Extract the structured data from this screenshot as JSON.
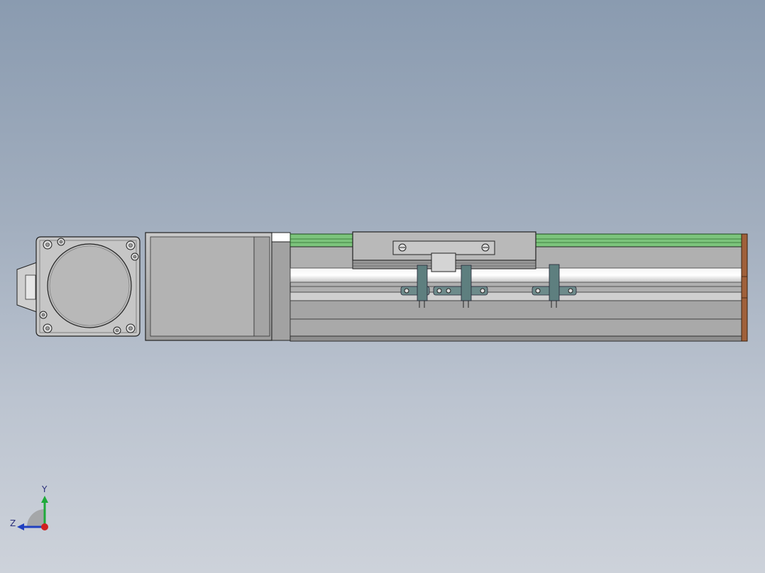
{
  "viewport": {
    "background_top": "#8a9bb0",
    "background_bottom": "#cdd2da"
  },
  "model": {
    "parts": [
      "stepper-motor",
      "motor-flange",
      "coupling-housing",
      "linear-rail-body",
      "carriage",
      "sensor-brackets",
      "end-cap"
    ],
    "colors": {
      "body_gray": "#a9a9a9",
      "rail_green": "#7cc47c",
      "bracket_teal": "#5e7f7f",
      "end_cap": "#a0603a"
    }
  },
  "triad": {
    "y_label": "Y",
    "z_label": "Z",
    "colors": {
      "y": "#1faa3a",
      "z": "#2040c0",
      "x": "#d02020"
    }
  }
}
